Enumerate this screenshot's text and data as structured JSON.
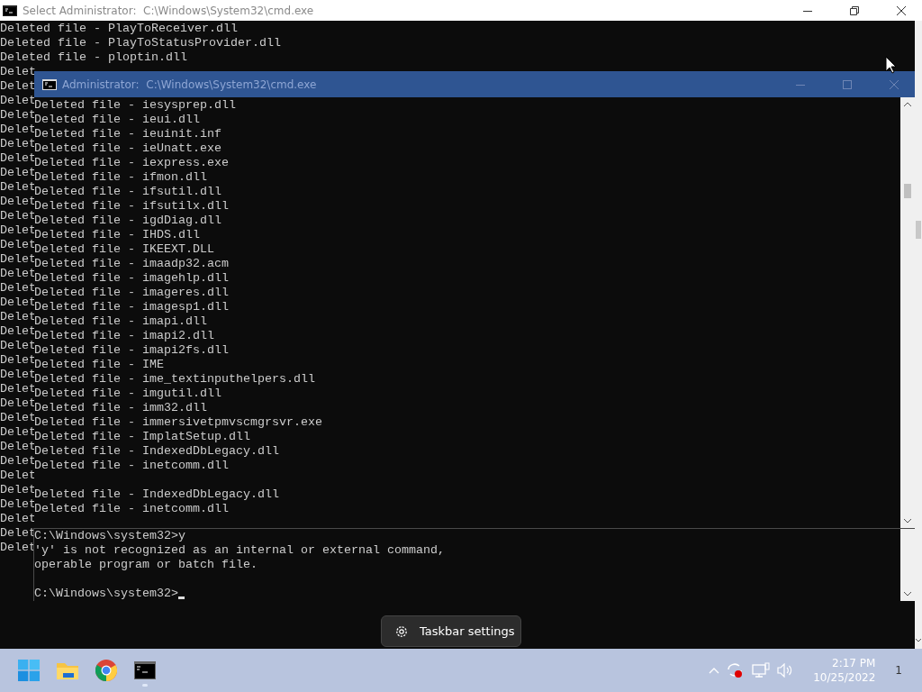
{
  "back_window": {
    "title": "Select Administrator:  C:\\Windows\\System32\\cmd.exe",
    "lines": [
      "Deleted file - PlayToReceiver.dll",
      "Deleted file - PlayToStatusProvider.dll",
      "Deleted file - ploptin.dll",
      "Delet",
      "Delet",
      "Delet",
      "Delet",
      "Delet",
      "Delet",
      "Delet",
      "Delet",
      "Delet",
      "Delet",
      "Delet",
      "Delet",
      "Delet",
      "Delet",
      "Delet",
      "Delet",
      "Delet",
      "Delet",
      "Delet",
      "Delet",
      "Delet",
      "Delet",
      "Delet",
      "Delet",
      "Delet",
      "Delet",
      "Delet",
      "Delet",
      "Delet",
      "Delet",
      "Delet",
      "Delet",
      "Delet",
      "Delet"
    ]
  },
  "front_window": {
    "title": "Administrator:  C:\\Windows\\System32\\cmd.exe",
    "output_blocks": [
      [
        "Deleted file - iesysprep.dll",
        "Deleted file - ieui.dll",
        "Deleted file - ieuinit.inf",
        "Deleted file - ieUnatt.exe",
        "Deleted file - iexpress.exe",
        "Deleted file - ifmon.dll",
        "Deleted file - ifsutil.dll",
        "Deleted file - ifsutilx.dll",
        "Deleted file - igdDiag.dll",
        "Deleted file - IHDS.dll",
        "Deleted file - IKEEXT.DLL",
        "Deleted file - imaadp32.acm",
        "Deleted file - imagehlp.dll",
        "Deleted file - imageres.dll",
        "Deleted file - imagesp1.dll",
        "Deleted file - imapi.dll",
        "Deleted file - imapi2.dll",
        "Deleted file - imapi2fs.dll",
        "Deleted file - IME",
        "Deleted file - ime_textinputhelpers.dll",
        "Deleted file - imgutil.dll",
        "Deleted file - imm32.dll",
        "Deleted file - immersivetpmvscmgrsvr.exe",
        "Deleted file - ImplatSetup.dll",
        "Deleted file - IndexedDbLegacy.dll",
        "Deleted file - inetcomm.dll"
      ],
      [
        "Deleted file - IndexedDbLegacy.dll",
        "Deleted file - inetcomm.dll"
      ]
    ],
    "pane_blocks": [
      [
        "C:\\Windows\\system32>y",
        "'y' is not recognized as an internal or external command,",
        "operable program or batch file."
      ],
      [
        "C:\\Windows\\system32>"
      ]
    ]
  },
  "tooltip": {
    "label": "Taskbar settings"
  },
  "taskbar": {
    "apps": [
      {
        "kind": "start",
        "running": false
      },
      {
        "kind": "folder",
        "running": false
      },
      {
        "kind": "browser",
        "running": false
      },
      {
        "kind": "terminal",
        "running": true
      }
    ],
    "tray": {
      "time": "2:17 PM",
      "date": "10/25/2022",
      "notification_count": "1"
    }
  }
}
